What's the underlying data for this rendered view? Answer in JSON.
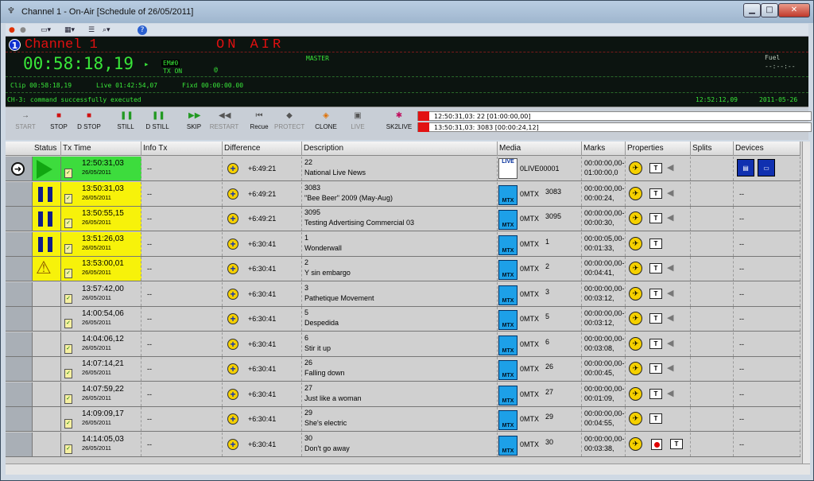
{
  "window": {
    "title": "Channel 1 - On-Air [Schedule of 26/05/2011]",
    "min_label": "▁",
    "max_label": "□",
    "close_label": "✕"
  },
  "toolbar": {
    "help_label": "?"
  },
  "onair_panel": {
    "channel_number": "1",
    "channel_name": "Channel 1",
    "status": "ON AIR",
    "clock": "00:58:18,19",
    "em": "EM#0",
    "tx_on": "TX ON",
    "at": "@",
    "master": "MASTER",
    "fuel_label": "Fuel",
    "fuel_value": "--:--:--",
    "clip": "Clip 00:58:18,19",
    "live": "Live 01:42:54,07",
    "fixd": "Fixd  00:00:00.00",
    "status_message": "CH-3: command successfully executed",
    "time": "12:52:12,09",
    "date": "2011-05-26"
  },
  "controls": [
    {
      "label": "START",
      "icon": "→",
      "disabled": true
    },
    {
      "label": "STOP",
      "icon": "■",
      "disabled": false
    },
    {
      "label": "D STOP",
      "icon": "■",
      "disabled": false
    },
    {
      "label": "STILL",
      "icon": "❚❚",
      "disabled": false
    },
    {
      "label": "D STILL",
      "icon": "❚❚",
      "disabled": false
    },
    {
      "label": "SKIP",
      "icon": "▶▶",
      "disabled": false
    },
    {
      "label": "RESTART",
      "icon": "◀◀",
      "disabled": true
    },
    {
      "label": "Recue",
      "icon": "⏮",
      "disabled": false
    },
    {
      "label": "PROTECT",
      "icon": "◆",
      "disabled": true
    },
    {
      "label": "CLONE",
      "icon": "◈",
      "disabled": false
    },
    {
      "label": "LIVE",
      "icon": "▣",
      "disabled": true
    },
    {
      "label": "SK2LIVE",
      "icon": "✱",
      "disabled": false
    }
  ],
  "log": [
    "12:50:31,03:  22 [01:00:00,00]",
    "13:50:31,03:  3083 [00:00:24,12]"
  ],
  "columns": [
    "Status",
    "Tx Time",
    "Info Tx",
    "Difference",
    "Description",
    "Media",
    "Marks",
    "Properties",
    "Splits",
    "Devices"
  ],
  "rows": [
    {
      "status": "play",
      "time": "12:50:31,03",
      "date": "26/05/2011",
      "info": "--",
      "diff": "+6:49:21",
      "desc1": "22",
      "desc2": "National Live News",
      "media": "LIVE",
      "mname": "0LIVE00001",
      "mnum": "",
      "mark1": "00:00:00,00-",
      "mark2": "01:00:00,0",
      "spk": true,
      "rec": false,
      "devices": true,
      "color": "green",
      "current": true
    },
    {
      "status": "pause",
      "time": "13:50:31,03",
      "date": "26/05/2011",
      "info": "--",
      "diff": "+6:49:21",
      "desc1": "3083",
      "desc2": "\"Bee Beer\" 2009 (May-Aug)",
      "media": "MTX",
      "mname": "0MTX",
      "mnum": "3083",
      "mark1": "00:00:00,00-",
      "mark2": "00:00:24,",
      "spk": true,
      "rec": false,
      "devices": false,
      "color": "yellow"
    },
    {
      "status": "pause",
      "time": "13:50:55,15",
      "date": "26/05/2011",
      "info": "--",
      "diff": "+6:49:21",
      "desc1": "3095",
      "desc2": "Testing Advertising Commercial 03",
      "media": "MTX",
      "mname": "0MTX",
      "mnum": "3095",
      "mark1": "00:00:00,00-",
      "mark2": "00:00:30,",
      "spk": true,
      "rec": false,
      "devices": false,
      "color": "yellow"
    },
    {
      "status": "pause",
      "time": "13:51:26,03",
      "date": "26/05/2011",
      "info": "--",
      "diff": "+6:30:41",
      "desc1": "1",
      "desc2": "Wonderwall",
      "media": "MTX",
      "mname": "0MTX",
      "mnum": "1",
      "mark1": "00:00:05,00-",
      "mark2": "00:01:33,",
      "spk": false,
      "rec": false,
      "devices": false,
      "color": "yellow"
    },
    {
      "status": "warn",
      "time": "13:53:00,01",
      "date": "26/05/2011",
      "info": "--",
      "diff": "+6:30:41",
      "desc1": "2",
      "desc2": "Y sin embargo",
      "media": "MTX",
      "mname": "0MTX",
      "mnum": "2",
      "mark1": "00:00:00,00-",
      "mark2": "00:04:41,",
      "spk": true,
      "rec": false,
      "devices": false,
      "color": "yellow"
    },
    {
      "status": "",
      "time": "13:57:42,00",
      "date": "26/05/2011",
      "info": "--",
      "diff": "+6:30:41",
      "desc1": "3",
      "desc2": "Pathetique Movement",
      "media": "MTX",
      "mname": "0MTX",
      "mnum": "3",
      "mark1": "00:00:00,00-",
      "mark2": "00:03:12,",
      "spk": true,
      "rec": false,
      "devices": false,
      "color": ""
    },
    {
      "status": "",
      "time": "14:00:54,06",
      "date": "26/05/2011",
      "info": "--",
      "diff": "+6:30:41",
      "desc1": "5",
      "desc2": "Despedida",
      "media": "MTX",
      "mname": "0MTX",
      "mnum": "5",
      "mark1": "00:00:00,00-",
      "mark2": "00:03:12,",
      "spk": true,
      "rec": false,
      "devices": false,
      "color": ""
    },
    {
      "status": "",
      "time": "14:04:06,12",
      "date": "26/05/2011",
      "info": "--",
      "diff": "+6:30:41",
      "desc1": "6",
      "desc2": "Stir it up",
      "media": "MTX",
      "mname": "0MTX",
      "mnum": "6",
      "mark1": "00:00:00,00-",
      "mark2": "00:03:08,",
      "spk": true,
      "rec": false,
      "devices": false,
      "color": ""
    },
    {
      "status": "",
      "time": "14:07:14,21",
      "date": "26/05/2011",
      "info": "--",
      "diff": "+6:30:41",
      "desc1": "26",
      "desc2": "Falling down",
      "media": "MTX",
      "mname": "0MTX",
      "mnum": "26",
      "mark1": "00:00:00,00-",
      "mark2": "00:00:45,",
      "spk": true,
      "rec": false,
      "devices": false,
      "color": ""
    },
    {
      "status": "",
      "time": "14:07:59,22",
      "date": "26/05/2011",
      "info": "--",
      "diff": "+6:30:41",
      "desc1": "27",
      "desc2": "Just like a woman",
      "media": "MTX",
      "mname": "0MTX",
      "mnum": "27",
      "mark1": "00:00:00,00-",
      "mark2": "00:01:09,",
      "spk": true,
      "rec": false,
      "devices": false,
      "color": ""
    },
    {
      "status": "",
      "time": "14:09:09,17",
      "date": "26/05/2011",
      "info": "--",
      "diff": "+6:30:41",
      "desc1": "29",
      "desc2": "She's electric",
      "media": "MTX",
      "mname": "0MTX",
      "mnum": "29",
      "mark1": "00:00:00,00-",
      "mark2": "00:04:55,",
      "spk": false,
      "rec": false,
      "devices": false,
      "color": ""
    },
    {
      "status": "",
      "time": "14:14:05,03",
      "date": "26/05/2011",
      "info": "--",
      "diff": "+6:30:41",
      "desc1": "30",
      "desc2": "Don't go away",
      "media": "MTX",
      "mname": "0MTX",
      "mnum": "30",
      "mark1": "00:00:00,00-",
      "mark2": "00:03:38,",
      "spk": false,
      "rec": true,
      "devices": false,
      "color": ""
    }
  ],
  "colors": {
    "onair_green": "#39e639",
    "onair_red": "#e01010",
    "row_green": "#3ddc3d",
    "row_yellow": "#f7f20a"
  }
}
